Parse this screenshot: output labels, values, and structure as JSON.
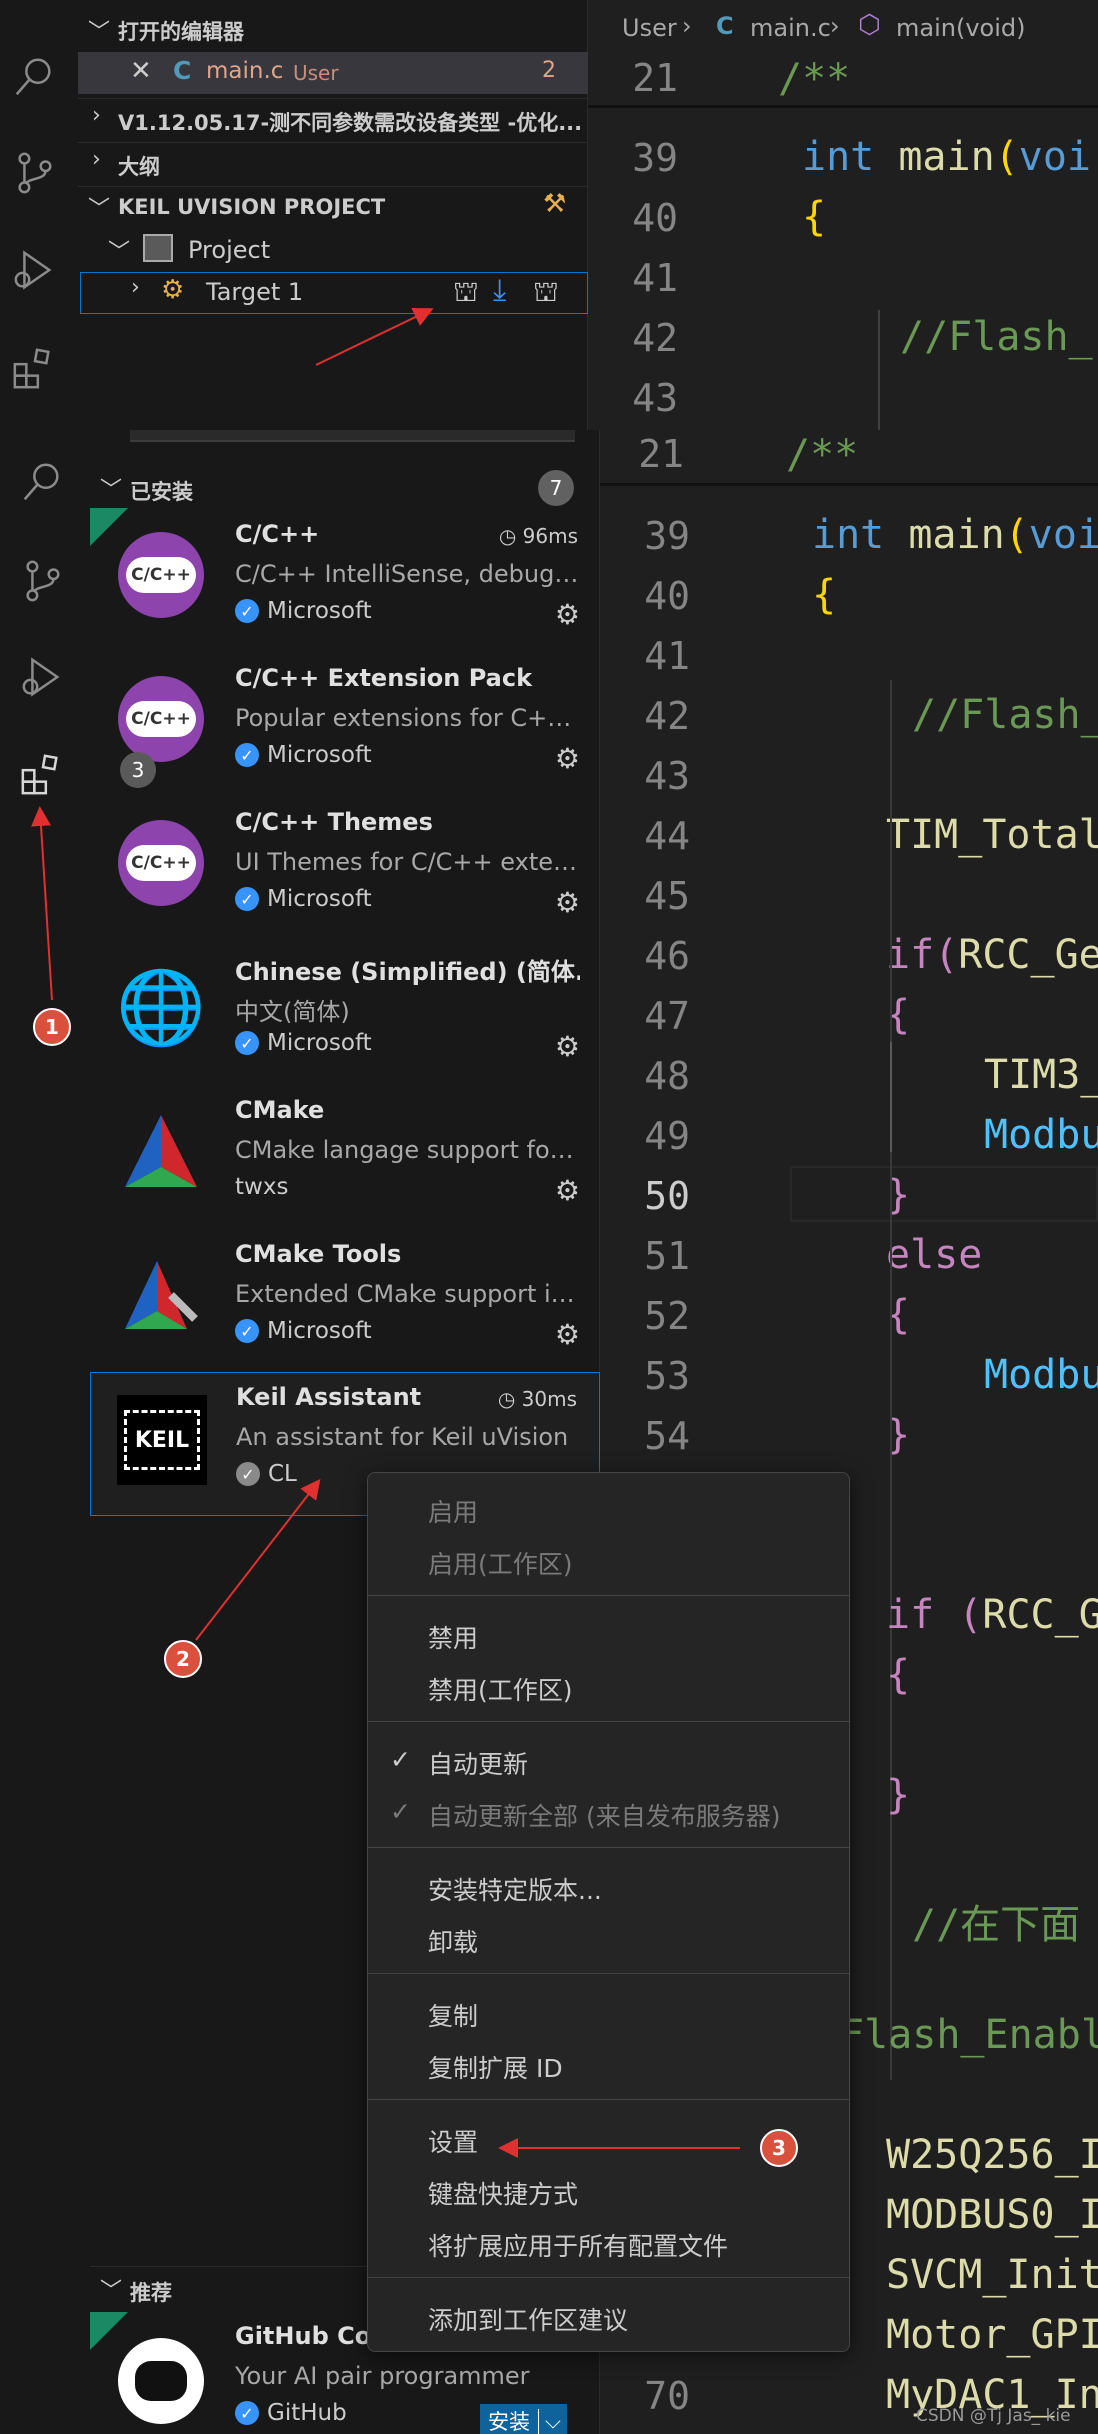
{
  "editors_panel": {
    "open_editors_title": "打开的编辑器",
    "open_file_name": "main.c",
    "open_file_folder": "User",
    "open_file_problems": "2",
    "workspace_title": "V1.12.05.17-测不同参数需改设备类型 -优化...",
    "outline_title": "大纲",
    "keil_title": "KEIL UVISION PROJECT",
    "project_label": "Project",
    "target_label": "Target 1"
  },
  "breadcrumb": {
    "folder": "User",
    "file": "main.c",
    "symbol": "main(void)"
  },
  "editor_top": {
    "lines": [
      {
        "n": "21",
        "code": "/**"
      },
      {
        "n": "39",
        "code": "int main(voi"
      },
      {
        "n": "40",
        "code": "{"
      },
      {
        "n": "41",
        "code": ""
      },
      {
        "n": "42",
        "code": "//Flash_"
      },
      {
        "n": "43",
        "code": ""
      }
    ]
  },
  "editor_main": {
    "sticky": {
      "n": "21",
      "code": "/**"
    },
    "lines": [
      {
        "n": "39",
        "code": "int main(voi"
      },
      {
        "n": "40",
        "code": "{"
      },
      {
        "n": "41",
        "code": ""
      },
      {
        "n": "42",
        "code": "//Flash_"
      },
      {
        "n": "43",
        "code": ""
      },
      {
        "n": "44",
        "code": "TIM_Total"
      },
      {
        "n": "45",
        "code": ""
      },
      {
        "n": "46",
        "code": "if(RCC_Ge"
      },
      {
        "n": "47",
        "code": "{"
      },
      {
        "n": "48",
        "code": "TIM3_"
      },
      {
        "n": "49",
        "code": "Modbu"
      },
      {
        "n": "50",
        "code": "}"
      },
      {
        "n": "51",
        "code": "else"
      },
      {
        "n": "52",
        "code": "{"
      },
      {
        "n": "53",
        "code": "Modbu"
      },
      {
        "n": "54",
        "code": "}"
      }
    ],
    "lower_code": [
      "if (RCC_G",
      "{",
      "}",
      "//在下面",
      "Flash_Enabl",
      "W25Q256_I",
      "MODBUS0_I",
      "SVCM_Init",
      "Motor_GPI",
      "MyDAC1_In"
    ],
    "last_line_number": "70",
    "watermark": "CSDN @Tj Jas_ kie"
  },
  "extensions": {
    "installed_title": "已安装",
    "installed_count": "7",
    "items": [
      {
        "name": "C/C++",
        "desc": "C/C++ IntelliSense, debuggi...",
        "publisher": "Microsoft",
        "timing": "96ms",
        "logo": "C/C++"
      },
      {
        "name": "C/C++ Extension Pack",
        "desc": "Popular extensions for C++ ...",
        "publisher": "Microsoft",
        "badge": "3",
        "logo": "C/C++"
      },
      {
        "name": "C/C++ Themes",
        "desc": "UI Themes for C/C++ exten...",
        "publisher": "Microsoft",
        "logo": "C/C++"
      },
      {
        "name": "Chinese (Simplified) (简体...",
        "desc": "中文(简体)",
        "publisher": "Microsoft"
      },
      {
        "name": "CMake",
        "desc": "CMake langage support for ...",
        "publisher": "twxs"
      },
      {
        "name": "CMake Tools",
        "desc": "Extended CMake support in ...",
        "publisher": "Microsoft"
      },
      {
        "name": "Keil Assistant",
        "desc": "An assistant for Keil uVision",
        "publisher": "CL",
        "timing": "30ms",
        "logo": "KEIL"
      }
    ],
    "recommended_title": "推荐",
    "recommended": {
      "name": "GitHub Cop",
      "desc": "Your AI pair programmer",
      "publisher": "GitHub",
      "install_label": "安装"
    }
  },
  "context_menu": {
    "enable": "启用",
    "enable_workspace": "启用(工作区)",
    "disable": "禁用",
    "disable_workspace": "禁用(工作区)",
    "auto_update": "自动更新",
    "auto_update_all": "自动更新全部 (来自发布服务器)",
    "install_version": "安装特定版本...",
    "uninstall": "卸载",
    "copy": "复制",
    "copy_id": "复制扩展 ID",
    "settings": "设置",
    "keyboard_shortcuts": "键盘快捷方式",
    "apply_all_profiles": "将扩展应用于所有配置文件",
    "add_workspace_rec": "添加到工作区建议"
  },
  "annotations": {
    "one": "1",
    "two": "2",
    "three": "3"
  },
  "colors": {
    "accent": "#0078d4",
    "badge": "#d9503c",
    "arrow": "#e03030"
  }
}
